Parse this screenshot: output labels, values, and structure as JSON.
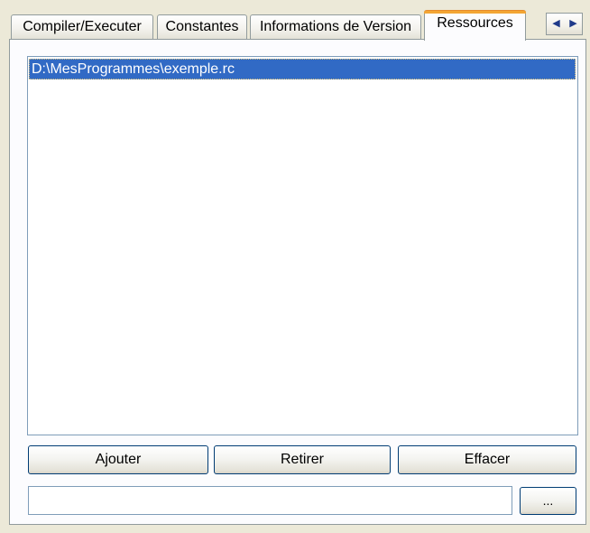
{
  "tabs": {
    "compiler": "Compiler/Executer",
    "constants": "Constantes",
    "version": "Informations de Version",
    "resources": "Ressources"
  },
  "tab_scroll": {
    "left": "◀",
    "right": "▶"
  },
  "resources_list": {
    "items": [
      "D:\\MesProgrammes\\exemple.rc"
    ],
    "selected_index": 0
  },
  "buttons": {
    "add": "Ajouter",
    "remove": "Retirer",
    "clear": "Effacer",
    "browse": "..."
  },
  "path_input": {
    "value": ""
  },
  "colors": {
    "selection": "#316ac5",
    "active_tab_accent": "#f3a634",
    "window_background": "#ece9d8"
  }
}
